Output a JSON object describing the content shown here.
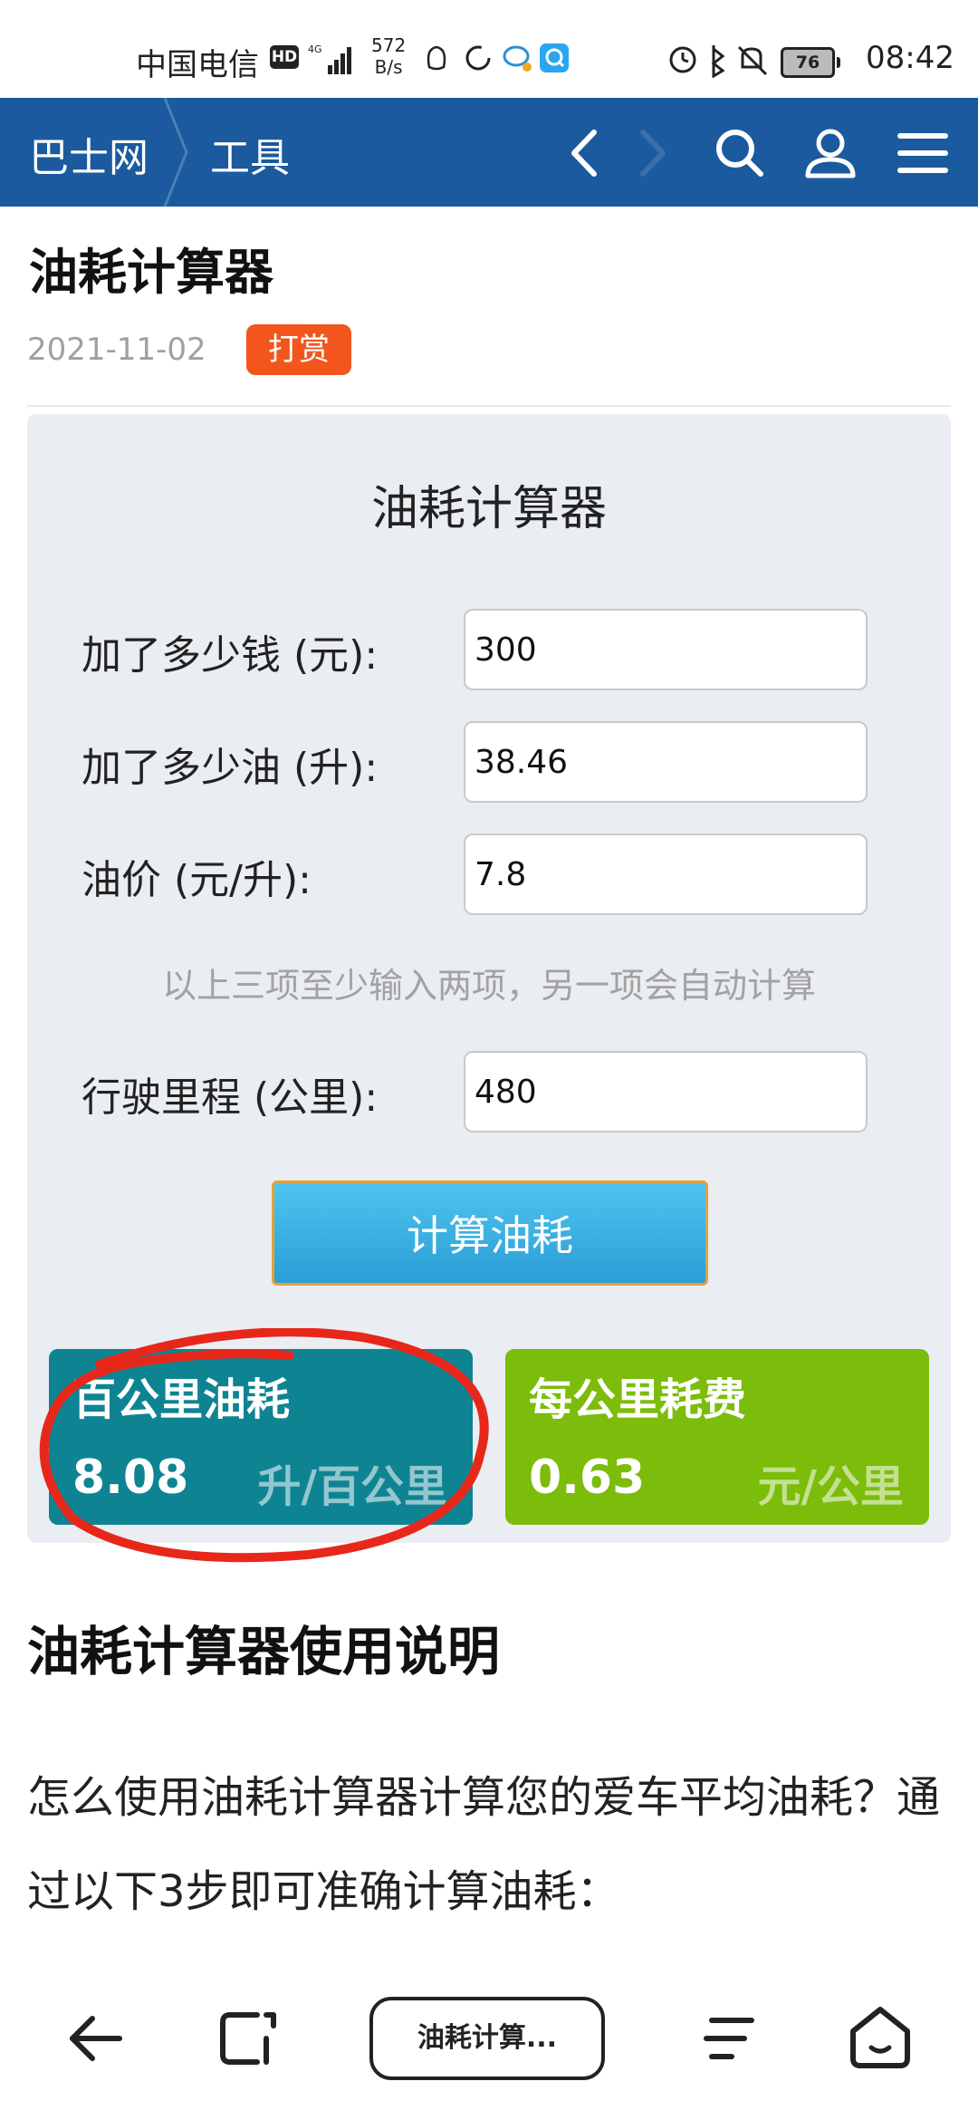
{
  "status_bar": {
    "carrier": "中国电信",
    "hd": "HD",
    "net_speed_value": "572",
    "net_speed_unit": "B/s",
    "battery": "76",
    "time": "08:42"
  },
  "navbar": {
    "logo": "巴士网",
    "section": "工具",
    "icons": [
      "back-icon",
      "forward-icon",
      "search-icon",
      "user-icon",
      "menu-icon"
    ]
  },
  "article": {
    "title": "油耗计算器",
    "date": "2021-11-02",
    "reward_label": "打赏"
  },
  "calculator": {
    "title": "油耗计算器",
    "fields": [
      {
        "label": "加了多少钱 (元):",
        "value": "300"
      },
      {
        "label": "加了多少油 (升):",
        "value": "38.46"
      },
      {
        "label": "油价 (元/升):",
        "value": "7.8"
      },
      {
        "label": "行驶里程 (公里):",
        "value": "480"
      }
    ],
    "hint": "以上三项至少输入两项，另一项会自动计算",
    "button_label": "计算油耗",
    "results": [
      {
        "title": "百公里油耗",
        "value": "8.08",
        "unit": "升/百公里",
        "color": "#0e8493"
      },
      {
        "title": "每公里耗费",
        "value": "0.63",
        "unit": "元/公里",
        "color": "#7cbc0a"
      }
    ],
    "annotation_color": "#e8271b"
  },
  "instructions": {
    "heading": "油耗计算器使用说明",
    "paragraph": "怎么使用油耗计算器计算您的爱车平均油耗？通过以下3步即可准确计算油耗："
  },
  "bottom_toolbar": {
    "tab_label": "油耗计算...",
    "icons": [
      "back-arrow-icon",
      "tabs-icon",
      "menu-lines-icon",
      "home-icon"
    ]
  },
  "colors": {
    "navbar": "#1b5a9e",
    "reward": "#f2561d",
    "panel": "#eaedf1",
    "button": "#2a9ed6"
  }
}
